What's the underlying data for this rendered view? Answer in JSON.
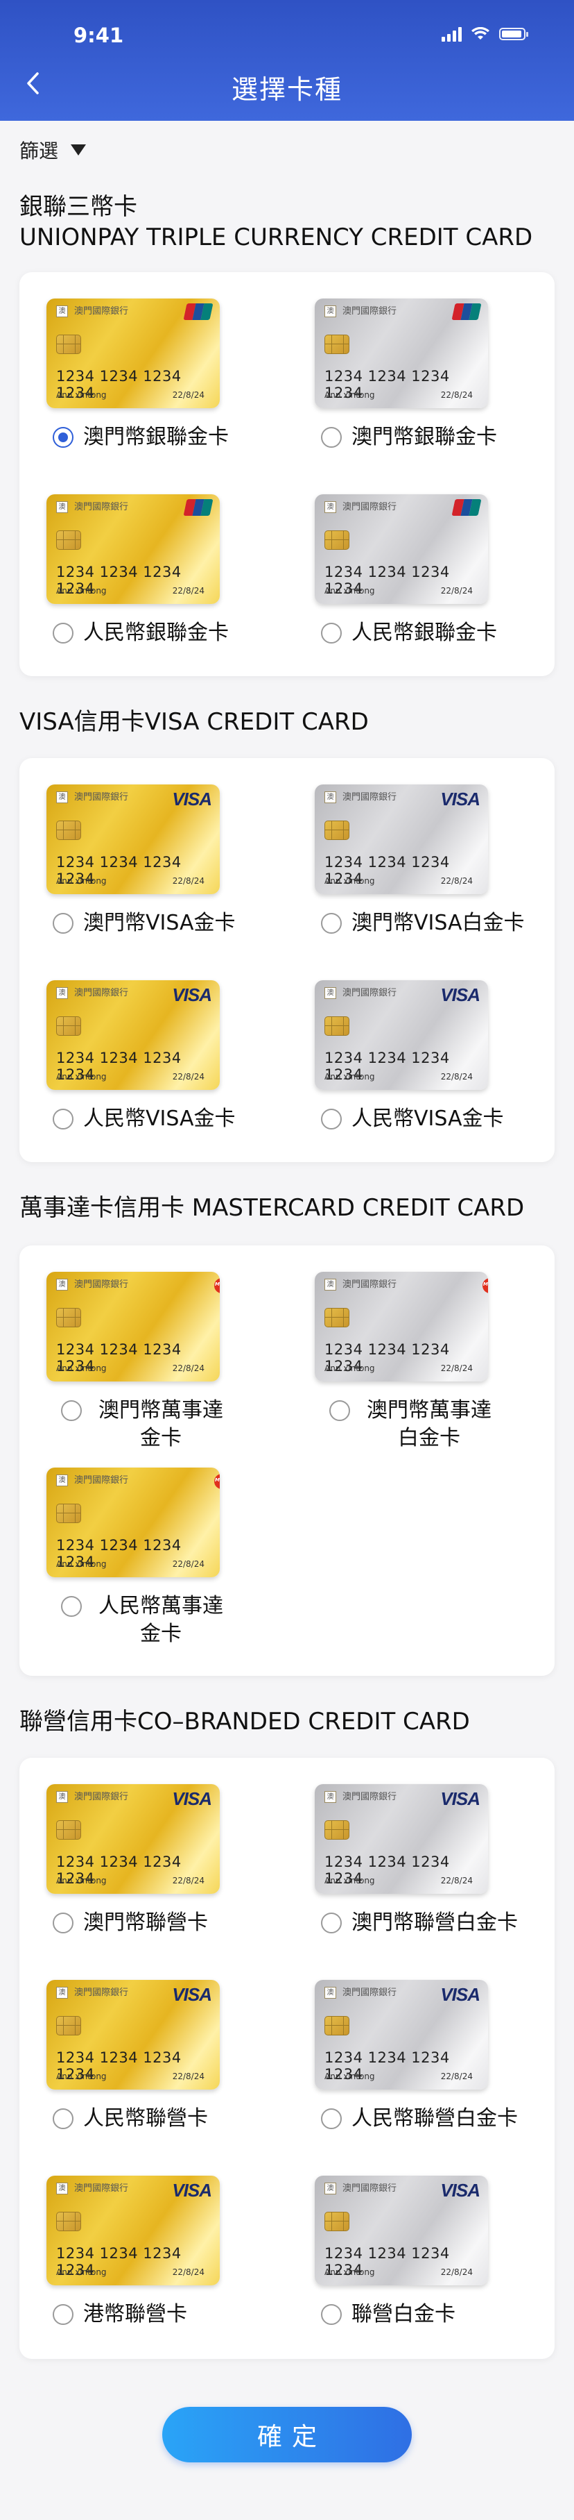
{
  "status_bar": {
    "time": "9:41"
  },
  "header": {
    "title": "選擇卡種"
  },
  "filter": {
    "label": "篩選"
  },
  "card_face": {
    "bank": "澳門國際銀行",
    "number": "1234 1234 1234 1234",
    "holder": "Ann xintong",
    "expiry": "22/8/24",
    "logo_char": "澳"
  },
  "sections": [
    {
      "title_lines": [
        "銀聯三幣卡",
        "UNIONPAY TRIPLE CURRENCY CREDIT CARD"
      ],
      "cards": [
        {
          "label": "澳門幣銀聯金卡",
          "style": "gold",
          "brand": "unionpay",
          "selected": true
        },
        {
          "label": "澳門幣銀聯金卡",
          "style": "silver",
          "brand": "unionpay",
          "selected": false
        },
        {
          "label": "人民幣銀聯金卡",
          "style": "gold",
          "brand": "unionpay",
          "selected": false
        },
        {
          "label": "人民幣銀聯金卡",
          "style": "silver",
          "brand": "unionpay",
          "selected": false
        }
      ]
    },
    {
      "title_lines": [
        "VISA信用卡VISA CREDIT CARD"
      ],
      "cards": [
        {
          "label": "澳門幣VISA金卡",
          "style": "gold",
          "brand": "visa",
          "selected": false
        },
        {
          "label": "澳門幣VISA白金卡",
          "style": "silver",
          "brand": "visa",
          "selected": false
        },
        {
          "label": "人民幣VISA金卡",
          "style": "gold",
          "brand": "visa",
          "selected": false
        },
        {
          "label": "人民幣VISA金卡",
          "style": "silver",
          "brand": "visa",
          "selected": false
        }
      ]
    },
    {
      "title_lines": [
        "萬事達卡信用卡 MASTERCARD CREDIT CARD"
      ],
      "cards": [
        {
          "label": "澳門幣萬事達金卡",
          "style": "gold",
          "brand": "mastercard",
          "selected": false
        },
        {
          "label": "澳門幣萬事達白金卡",
          "style": "silver",
          "brand": "mastercard",
          "selected": false
        },
        {
          "label": "人民幣萬事達金卡",
          "style": "gold",
          "brand": "mastercard",
          "selected": false
        }
      ]
    },
    {
      "title_lines": [
        "聯營信用卡CO–BRANDED CREDIT CARD"
      ],
      "cards": [
        {
          "label": "澳門幣聯營卡",
          "style": "gold",
          "brand": "visa",
          "selected": false
        },
        {
          "label": "澳門幣聯營白金卡",
          "style": "silver",
          "brand": "visa",
          "selected": false
        },
        {
          "label": "人民幣聯營卡",
          "style": "gold",
          "brand": "visa",
          "selected": false
        },
        {
          "label": "人民幣聯營白金卡",
          "style": "silver",
          "brand": "visa",
          "selected": false
        },
        {
          "label": "港幣聯營卡",
          "style": "gold",
          "brand": "visa",
          "selected": false
        },
        {
          "label": "聯營白金卡",
          "style": "silver",
          "brand": "visa",
          "selected": false
        }
      ]
    }
  ],
  "brand_labels": {
    "visa": "VISA",
    "mastercard": "MasterCard"
  },
  "colors": {
    "header": "#2f52c4",
    "accent": "#2f5fd8",
    "unionpay": [
      "#d3232a",
      "#1c4f9c",
      "#05807a"
    ]
  },
  "confirm_button": {
    "label": "確定"
  }
}
